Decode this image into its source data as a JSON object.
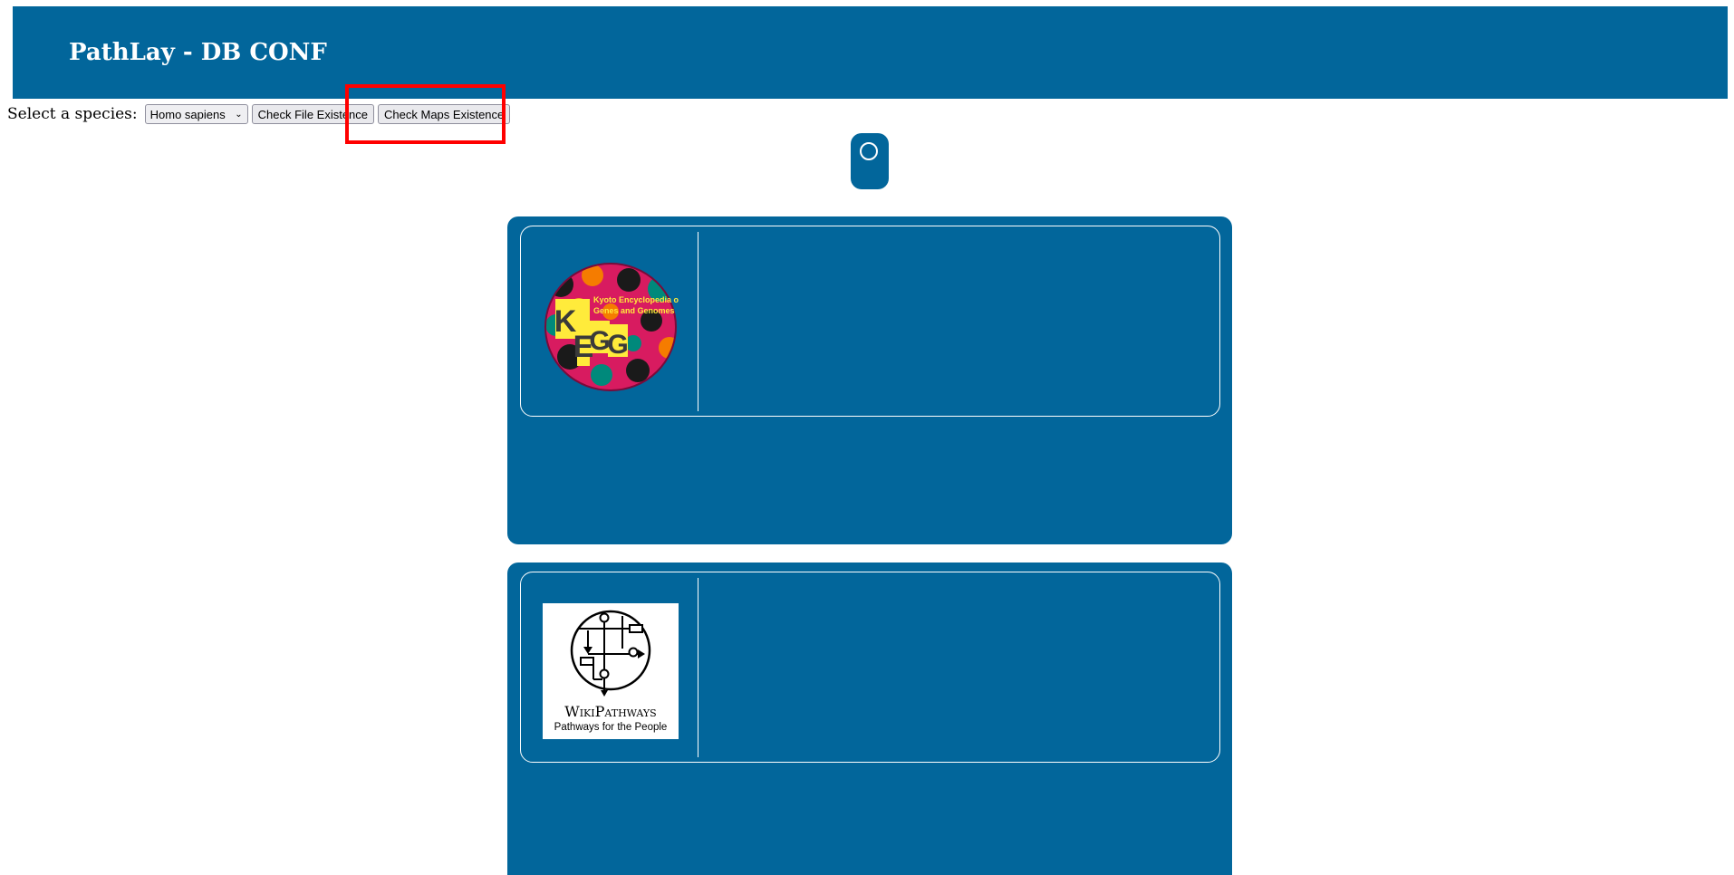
{
  "header": {
    "title": "PathLay - DB CONF"
  },
  "toolbar": {
    "species_label": "Select a species:",
    "species_selected": "Homo sapiens",
    "check_file_label": "Check File Existence",
    "check_maps_label": "Check Maps Existence"
  },
  "databases": {
    "kegg": {
      "logo_text_line1": "Kyoto Encyclopedia of",
      "logo_text_line2": "Genes and Genomes",
      "logo_mark": "KEGG"
    },
    "wikipathways": {
      "brand": "WikiPathways",
      "tagline": "Pathways for the People"
    }
  },
  "colors": {
    "primary": "#02669b",
    "highlight": "#ff0000"
  }
}
